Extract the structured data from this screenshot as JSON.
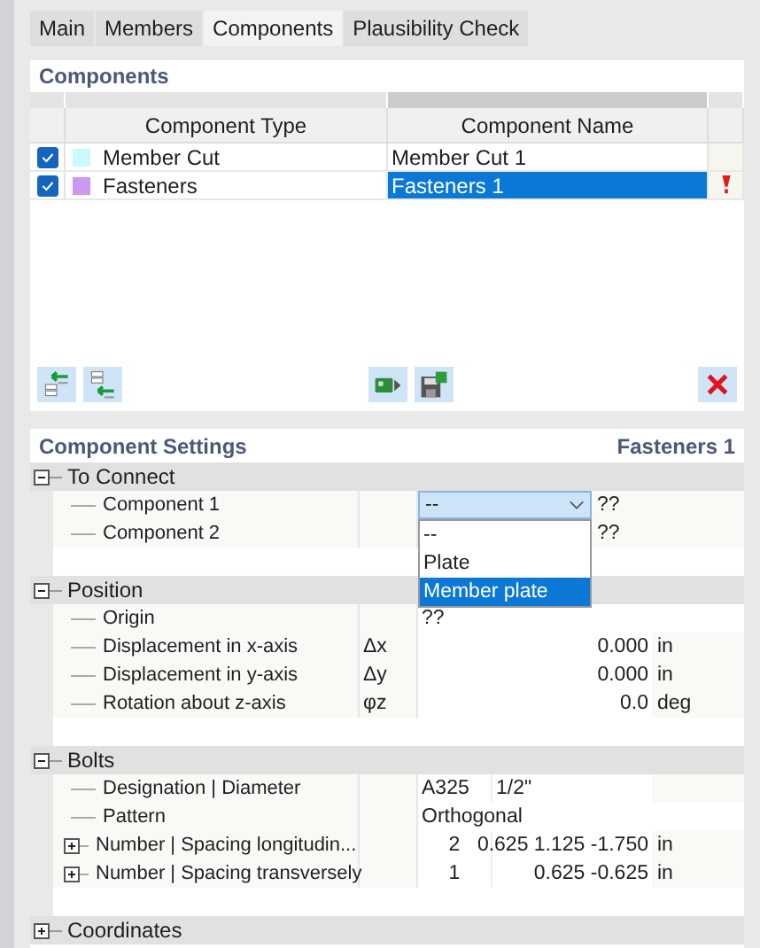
{
  "tabs": [
    {
      "label": "Main",
      "selected": false
    },
    {
      "label": "Members",
      "selected": false
    },
    {
      "label": "Components",
      "selected": true
    },
    {
      "label": "Plausibility Check",
      "selected": false
    }
  ],
  "components": {
    "title": "Components",
    "columns": [
      "Component Type",
      "Component Name"
    ],
    "rows": [
      {
        "checked": true,
        "color": "#ccfafc",
        "type": "Member Cut",
        "name": "Member Cut 1",
        "selected": false,
        "warning": false
      },
      {
        "checked": true,
        "color": "#cc99f0",
        "type": "Fasteners",
        "name": "Fasteners 1",
        "selected": true,
        "warning": true
      }
    ]
  },
  "settings": {
    "title": "Component Settings",
    "current": "Fasteners 1",
    "groups": [
      {
        "label": "To Connect",
        "expanded": true,
        "rows": [
          {
            "kind": "link",
            "label": "Component 1",
            "note": "??",
            "combo": {
              "value": "--",
              "open": true,
              "options": [
                {
                  "label": "--",
                  "highlighted": false
                },
                {
                  "label": "Plate",
                  "highlighted": false
                },
                {
                  "label": "Member plate",
                  "highlighted": true
                }
              ]
            }
          },
          {
            "kind": "link",
            "label": "Component 2",
            "note": "??"
          }
        ]
      },
      {
        "label": "Position",
        "expanded": true,
        "rows": [
          {
            "kind": "text",
            "label": "Origin",
            "value": "??"
          },
          {
            "kind": "number",
            "label": "Displacement in x-axis",
            "symbol": "Δx",
            "value": "0.000",
            "unit": "in"
          },
          {
            "kind": "number",
            "label": "Displacement in y-axis",
            "symbol": "Δy",
            "value": "0.000",
            "unit": "in"
          },
          {
            "kind": "number",
            "label": "Rotation about z-axis",
            "symbol": "φz",
            "value": "0.0",
            "unit": "deg"
          }
        ]
      },
      {
        "label": "Bolts",
        "expanded": true,
        "rows": [
          {
            "kind": "pair",
            "label": "Designation | Diameter",
            "value": "A325",
            "value_2": "1/2\""
          },
          {
            "kind": "text",
            "label": "Pattern",
            "value": "Orthogonal"
          },
          {
            "kind": "count",
            "label": "Number | Spacing longitudin...",
            "value": "2",
            "value_2": "0.625 1.125 -1.750",
            "unit": "in",
            "expanded": false
          },
          {
            "kind": "count",
            "label": "Number | Spacing transversely",
            "value": "1",
            "value_2": "0.625 -0.625",
            "unit": "in",
            "expanded": false
          }
        ]
      },
      {
        "label": "Coordinates",
        "expanded": false
      }
    ]
  }
}
